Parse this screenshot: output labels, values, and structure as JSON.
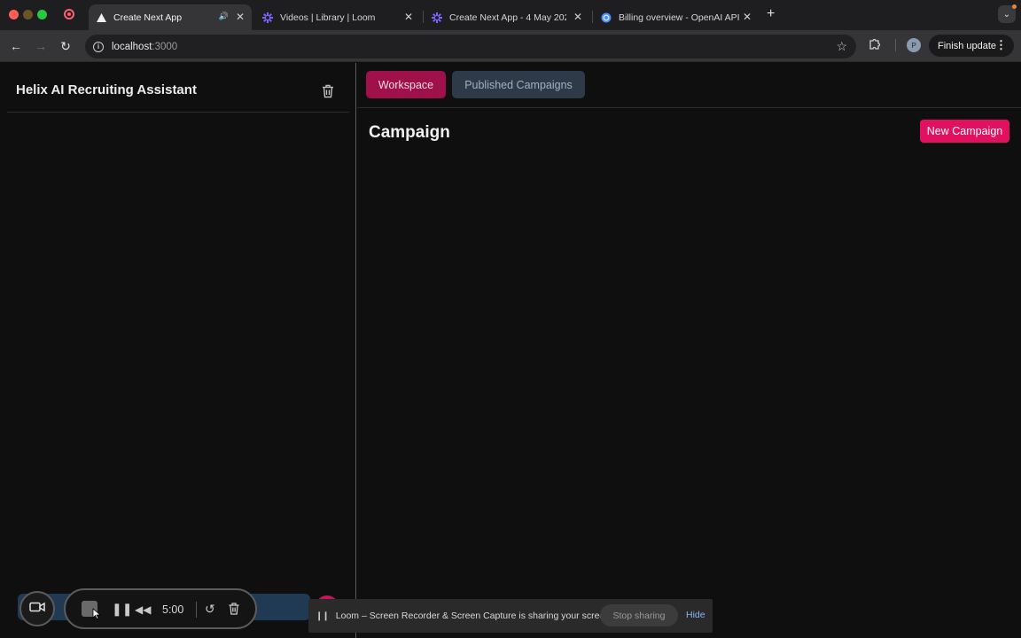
{
  "browser": {
    "tabs": [
      {
        "title": "Create Next App",
        "active": true,
        "icon": "nextjs-triangle-icon"
      },
      {
        "title": "Videos | Library | Loom",
        "active": false,
        "icon": "loom-icon"
      },
      {
        "title": "Create Next App - 4 May 202",
        "active": false,
        "icon": "loom-icon"
      },
      {
        "title": "Billing overview - OpenAI API",
        "active": false,
        "icon": "openai-globe-icon"
      }
    ],
    "url_host": "localhost",
    "url_port": ":3000",
    "finish_update_label": "Finish update",
    "profile_initial": "P"
  },
  "sidebar": {
    "title": "Helix AI Recruiting Assistant"
  },
  "main": {
    "tabs": [
      {
        "label": "Workspace",
        "selected": true
      },
      {
        "label": "Published Campaigns",
        "selected": false
      }
    ],
    "heading": "Campaign",
    "new_campaign_label": "New Campaign"
  },
  "loom": {
    "timer": "5:00",
    "share_message": "Loom – Screen Recorder & Screen Capture is sharing your screen.",
    "stop_sharing_label": "Stop sharing",
    "hide_label": "Hide"
  },
  "colors": {
    "accent_pink": "#e0115f",
    "workspace_tab": "#a0104a",
    "published_tab": "#2e3a48",
    "background": "#0f0f0f"
  }
}
